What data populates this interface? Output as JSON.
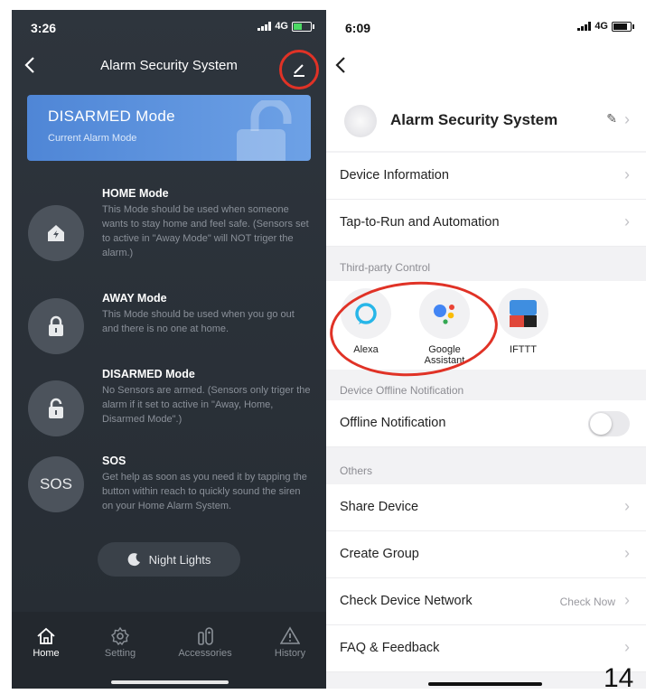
{
  "left": {
    "status": {
      "time": "3:26",
      "network": "4G"
    },
    "header": {
      "title": "Alarm Security System"
    },
    "current_mode": {
      "title": "DISARMED Mode",
      "subtitle": "Current Alarm Mode"
    },
    "modes": [
      {
        "title": "HOME Mode",
        "desc": "This Mode should be used when someone wants to stay home and feel safe. (Sensors set to active in \"Away Mode\" will NOT triger the alarm.)",
        "icon": "home-icon"
      },
      {
        "title": "AWAY Mode",
        "desc": "This Mode should be used when you go out and there is no one at home.",
        "icon": "lock-icon"
      },
      {
        "title": "DISARMED Mode",
        "desc": "No Sensors are armed. (Sensors only triger the alarm if it set to active in \"Away, Home, Disarmed Mode\".)",
        "icon": "unlock-icon"
      },
      {
        "title": "SOS",
        "desc": "Get help as soon as you need it by tapping the button within reach to quickly sound the siren on your Home Alarm System.",
        "icon_text": "SOS"
      }
    ],
    "night_lights": "Night Lights",
    "tabs": [
      {
        "label": "Home",
        "icon": "home-outline-icon"
      },
      {
        "label": "Setting",
        "icon": "gear-icon"
      },
      {
        "label": "Accessories",
        "icon": "sensor-icon"
      },
      {
        "label": "History",
        "icon": "warning-icon"
      }
    ],
    "colors": {
      "background": "#2a3037",
      "accent": "#5b93df",
      "highlight": "#e03226"
    }
  },
  "right": {
    "status": {
      "time": "6:09",
      "network": "4G"
    },
    "device": {
      "name": "Alarm Security System"
    },
    "rows_top": [
      {
        "label": "Device Information"
      },
      {
        "label": "Tap-to-Run and Automation"
      }
    ],
    "third_party": {
      "section": "Third-party Control",
      "items": [
        {
          "label": "Alexa",
          "icon": "alexa-icon"
        },
        {
          "label": "Google Assistant",
          "icon": "google-assistant-icon"
        },
        {
          "label": "IFTTT",
          "icon": "ifttt-icon"
        }
      ]
    },
    "offline": {
      "section": "Device Offline Notification",
      "label": "Offline Notification",
      "enabled": false
    },
    "others": {
      "section": "Others",
      "rows": [
        {
          "label": "Share Device",
          "value": ""
        },
        {
          "label": "Create Group",
          "value": ""
        },
        {
          "label": "Check Device Network",
          "value": "Check Now"
        },
        {
          "label": "FAQ & Feedback",
          "value": ""
        }
      ]
    }
  },
  "page_number": "14"
}
